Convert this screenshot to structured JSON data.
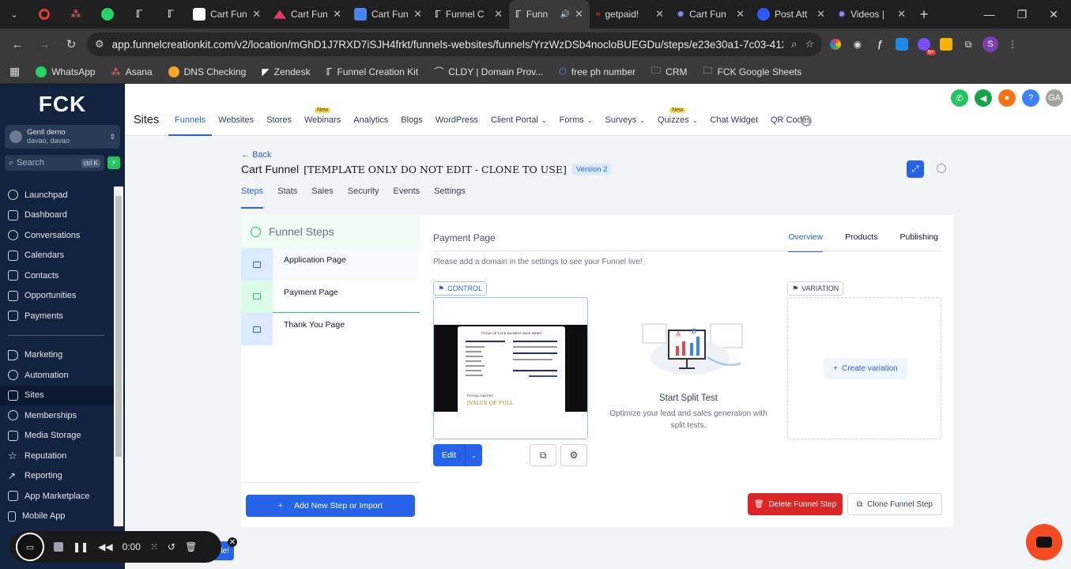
{
  "browser": {
    "tabs": [
      {
        "label": "Cart Funn",
        "color": "#ffffff"
      },
      {
        "label": "Cart Fun",
        "color": "#e23c62"
      },
      {
        "label": "Cart Fun",
        "color": "#4b84f0"
      },
      {
        "label": "Funnel C",
        "color": "#ffffff"
      },
      {
        "label": "Funn",
        "color": "#ffffff",
        "active": true
      },
      {
        "label": "getpaid!",
        "color": "#d33"
      },
      {
        "label": "Cart Fun",
        "color": "#6b6bff"
      },
      {
        "label": "Post Att",
        "color": "#2d5bff"
      },
      {
        "label": "Videos |",
        "color": "#7b5cff"
      }
    ],
    "url": "app.funnelcreationkit.com/v2/location/mGhD1J7RXD7iSJH4frkt/funnels-websites/funnels/YrzWzDSb4nocloBUEGDu/steps/e23e30a1-7c03-4123-8a02-0...",
    "profile_initial": "S",
    "ext_badge": "9+",
    "bookmarks": [
      "WhatsApp",
      "Asana",
      "DNS Checking",
      "Zendesk",
      "Funnel Creation Kit",
      "CLDY | Domain Prov...",
      "free ph number",
      "CRM",
      "FCK Google Sheets"
    ]
  },
  "sidebar": {
    "logo": "FCK",
    "account_name": "Genil demo",
    "account_sub": "davao, davao",
    "search_placeholder": "Search",
    "search_kbd": "ctrl K",
    "group1": [
      "Launchpad",
      "Dashboard",
      "Conversations",
      "Calendars",
      "Contacts",
      "Opportunities",
      "Payments"
    ],
    "group2": [
      "Marketing",
      "Automation",
      "Sites",
      "Memberships",
      "Media Storage",
      "Reputation",
      "Reporting",
      "App Marketplace",
      "Mobile App"
    ],
    "active": "Sites"
  },
  "topnav": {
    "title": "Sites",
    "menu": [
      "Funnels",
      "Websites",
      "Stores",
      "Webinars",
      "Analytics",
      "Blogs",
      "WordPress",
      "Client Portal",
      "Forms",
      "Surveys",
      "Quizzes",
      "Chat Widget",
      "QR Codes"
    ],
    "new_badge": "New",
    "avatar_initials": "GA"
  },
  "funnel": {
    "back": "Back",
    "name": "Cart Funnel",
    "name_note": "[TEMPLATE ONLY DO NOT EDIT - CLONE TO USE]",
    "version": "Version 2",
    "subtabs": [
      "Steps",
      "Stats",
      "Sales",
      "Security",
      "Events",
      "Settings"
    ]
  },
  "steps": {
    "heading": "Funnel Steps",
    "items": [
      "Application Page",
      "Payment Page",
      "Thank You Page"
    ],
    "add_label": "Add New Step or Import"
  },
  "detail": {
    "title": "Payment Page",
    "tabs": [
      "Overview",
      "Products",
      "Publishing"
    ],
    "note": "Please add a domain in the settings to see your Funnel live!",
    "control_label": "CONTROL",
    "variation_label": "VARIATION",
    "preview_heading": "[TITLE OF YOUR PAYMENT PAGE HERE]",
    "preview_total": "[TOTAL VALUE]",
    "preview_value": "[VALUE OF FULL",
    "edit_label": "Edit",
    "split_title": "Start Split Test",
    "split_sub": "Optimize your lead and sales generation with split tests.",
    "create_variation": "Create variation",
    "delete_label": "Delete Funnel Step",
    "clone_label": "Clone Funnel Step"
  },
  "recorder": {
    "time": "0:00"
  }
}
